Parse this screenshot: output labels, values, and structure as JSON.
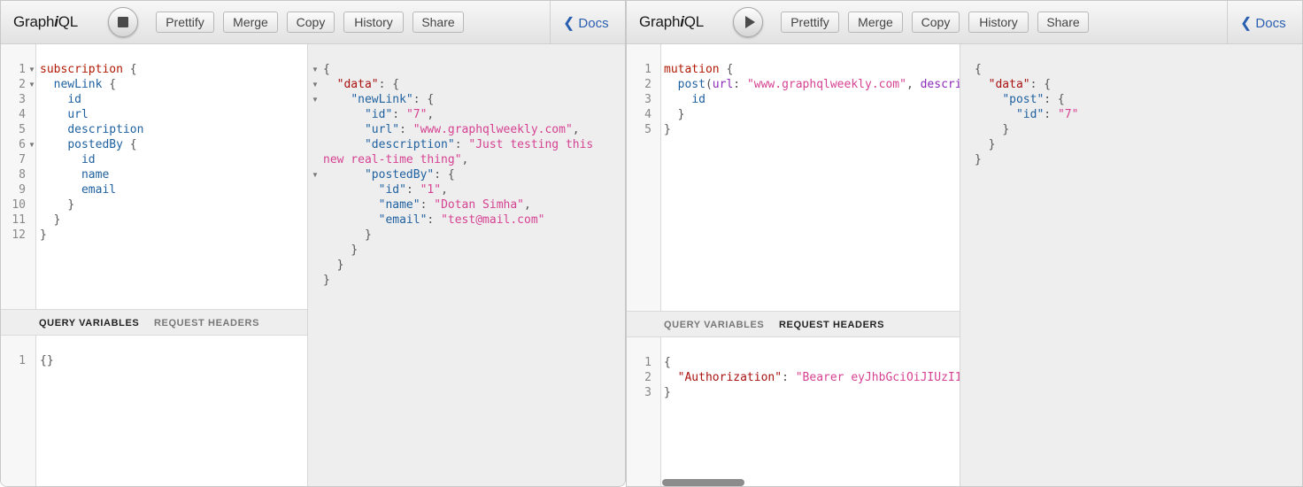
{
  "left": {
    "logo_prefix": "Graph",
    "logo_i": "i",
    "logo_suffix": "QL",
    "toolbar": {
      "prettify": "Prettify",
      "merge": "Merge",
      "copy": "Copy",
      "history": "History",
      "share": "Share"
    },
    "docs_label": "Docs",
    "query_lines": [
      "1",
      "2",
      "3",
      "4",
      "5",
      "6",
      "7",
      "8",
      "9",
      "10",
      "11",
      "12"
    ],
    "query_tokens": {
      "l1_kw": "subscription",
      "l1_p": " {",
      "l2_f": "newLink",
      "l2_p": " {",
      "l3_f": "id",
      "l4_f": "url",
      "l5_f": "description",
      "l6_f": "postedBy",
      "l6_p": " {",
      "l7_f": "id",
      "l8_f": "name",
      "l9_f": "email",
      "l10_p": "}",
      "l11_p": "}",
      "l12_p": "}"
    },
    "variables_tab": "QUERY VARIABLES",
    "headers_tab": "REQUEST HEADERS",
    "variables_lines": [
      "1"
    ],
    "variables_text": "{}",
    "result": {
      "r1": "{",
      "r2_k": "\"data\"",
      "r2_p": ": {",
      "r3_k": "\"newLink\"",
      "r3_p": ": {",
      "r4_k": "\"id\"",
      "r4_c": ": ",
      "r4_v": "\"7\"",
      "r4_e": ",",
      "r5_k": "\"url\"",
      "r5_c": ": ",
      "r5_v": "\"www.graphqlweekly.com\"",
      "r5_e": ",",
      "r6_k": "\"description\"",
      "r6_c": ": ",
      "r6_v": "\"Just testing this",
      "r7_v": "new real-time thing\"",
      "r7_e": ",",
      "r8_k": "\"postedBy\"",
      "r8_p": ": {",
      "r9_k": "\"id\"",
      "r9_c": ": ",
      "r9_v": "\"1\"",
      "r9_e": ",",
      "r10_k": "\"name\"",
      "r10_c": ": ",
      "r10_v": "\"Dotan Simha\"",
      "r10_e": ",",
      "r11_k": "\"email\"",
      "r11_c": ": ",
      "r11_v": "\"test@mail.com\"",
      "r12": "}",
      "r13": "}",
      "r14": "}",
      "r15": "}"
    }
  },
  "right": {
    "logo_prefix": "Graph",
    "logo_i": "i",
    "logo_suffix": "QL",
    "toolbar": {
      "prettify": "Prettify",
      "merge": "Merge",
      "copy": "Copy",
      "history": "History",
      "share": "Share"
    },
    "docs_label": "Docs",
    "query_lines": [
      "1",
      "2",
      "3",
      "4",
      "5"
    ],
    "query_tokens": {
      "l1_kw": "mutation",
      "l1_p": " {",
      "l2_f": "post",
      "l2_p1": "(",
      "l2_a1": "url",
      "l2_c1": ": ",
      "l2_s1": "\"www.graphqlweekly.com\"",
      "l2_c2": ", ",
      "l2_a2": "descri",
      "l3_f": "id",
      "l4_p": "}",
      "l5_p": "}"
    },
    "variables_tab": "QUERY VARIABLES",
    "headers_tab": "REQUEST HEADERS",
    "headers_lines": [
      "1",
      "2",
      "3"
    ],
    "headers": {
      "h1": "{",
      "h2_k": "\"Authorization\"",
      "h2_c": ": ",
      "h2_v": "\"Bearer eyJhbGciOiJIUzI1",
      "h3": "}"
    },
    "result": {
      "r1": "{",
      "r2_k": "\"data\"",
      "r2_p": ": {",
      "r3_k": "\"post\"",
      "r3_p": ": {",
      "r4_k": "\"id\"",
      "r4_c": ": ",
      "r4_v": "\"7\"",
      "r5": "}",
      "r6": "}",
      "r7": "}"
    }
  }
}
